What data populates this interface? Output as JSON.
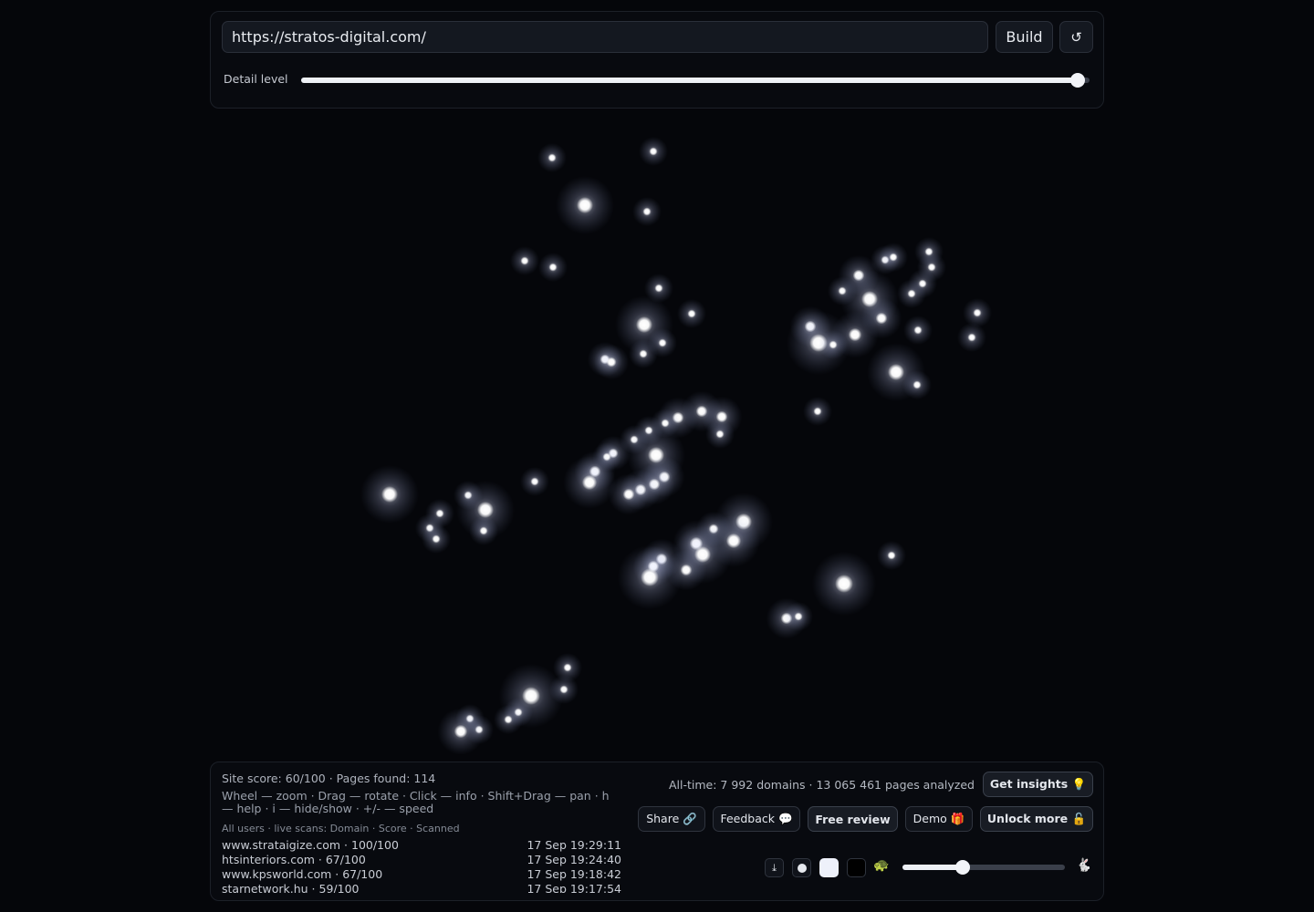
{
  "top": {
    "url_value": "https://stratos-digital.com/",
    "build_label": "Build",
    "reset_icon": "↺",
    "detail_label": "Detail level",
    "detail_level": 0.985
  },
  "bottom": {
    "site_stats": "Site score: 60/100 · Pages found: 114",
    "help": "Wheel — zoom · Drag — rotate · Click — info · Shift+Drag — pan · h — help · i — hide/show · +/- — speed",
    "scans_header": "All users · live scans: Domain · Score · Scanned",
    "scans": [
      {
        "domain": "www.strataigize.com · 100/100",
        "time": "17 Sep 19:29:11"
      },
      {
        "domain": "htsinteriors.com · 67/100",
        "time": "17 Sep 19:24:40"
      },
      {
        "domain": "www.kpsworld.com · 67/100",
        "time": "17 Sep 19:18:42"
      },
      {
        "domain": "starnetwork.hu · 59/100",
        "time": "17 Sep 19:17:54"
      }
    ],
    "alltime": "All-time: 7 992 domains · 13 065 461 pages analyzed",
    "buttons": {
      "insights": "Get insights 💡",
      "share": "Share 🔗",
      "feedback": "Feedback 💬",
      "review": "Free review",
      "demo": "Demo 🎁",
      "unlock": "Unlock more 🔓"
    },
    "speed_level": 0.37,
    "turtle": "🐢",
    "rabbit": "🐇",
    "download_icon": "⤓"
  }
}
